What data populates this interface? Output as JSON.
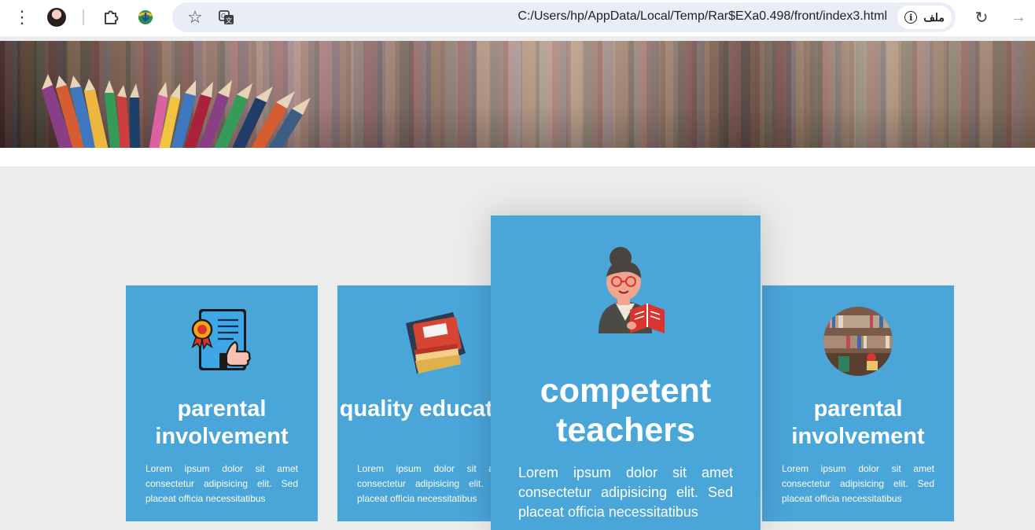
{
  "browser": {
    "url": "C:/Users/hp/AppData/Local/Temp/Rar$EXa0.498/front/index3.html",
    "site_info_label": "ملف",
    "icons": [
      "menu-dots-icon",
      "avatar",
      "extensions-icon",
      "idm-icon",
      "bookmark-star-icon",
      "translate-icon",
      "info-icon",
      "reload-icon",
      "back-arrow-icon"
    ]
  },
  "cards": [
    {
      "title": "parental involvement",
      "desc": "Lorem ipsum dolor sit amet consectetur adipisicing elit. Sed placeat officia necessitatibus",
      "icon": "certificate-thumbs-up-icon"
    },
    {
      "title": "quality education",
      "desc": "Lorem ipsum dolor sit amet consectetur adipisicing elit. Sed placeat officia necessitatibus",
      "icon": "book-stack-icon"
    },
    {
      "title": "competent teachers",
      "desc": "Lorem ipsum dolor sit amet consectetur adipisicing elit. Sed placeat officia necessitatibus",
      "icon": "teacher-with-book-icon"
    },
    {
      "title": "parental involvement",
      "desc": "Lorem ipsum dolor sit amet consectetur adipisicing elit. Sed placeat officia necessitatibus",
      "icon": "library-shelf-photo"
    }
  ],
  "colors": {
    "card_blue": "#4aa5d9",
    "page_background": "#ececec",
    "omnibox": "#e9eef6"
  }
}
